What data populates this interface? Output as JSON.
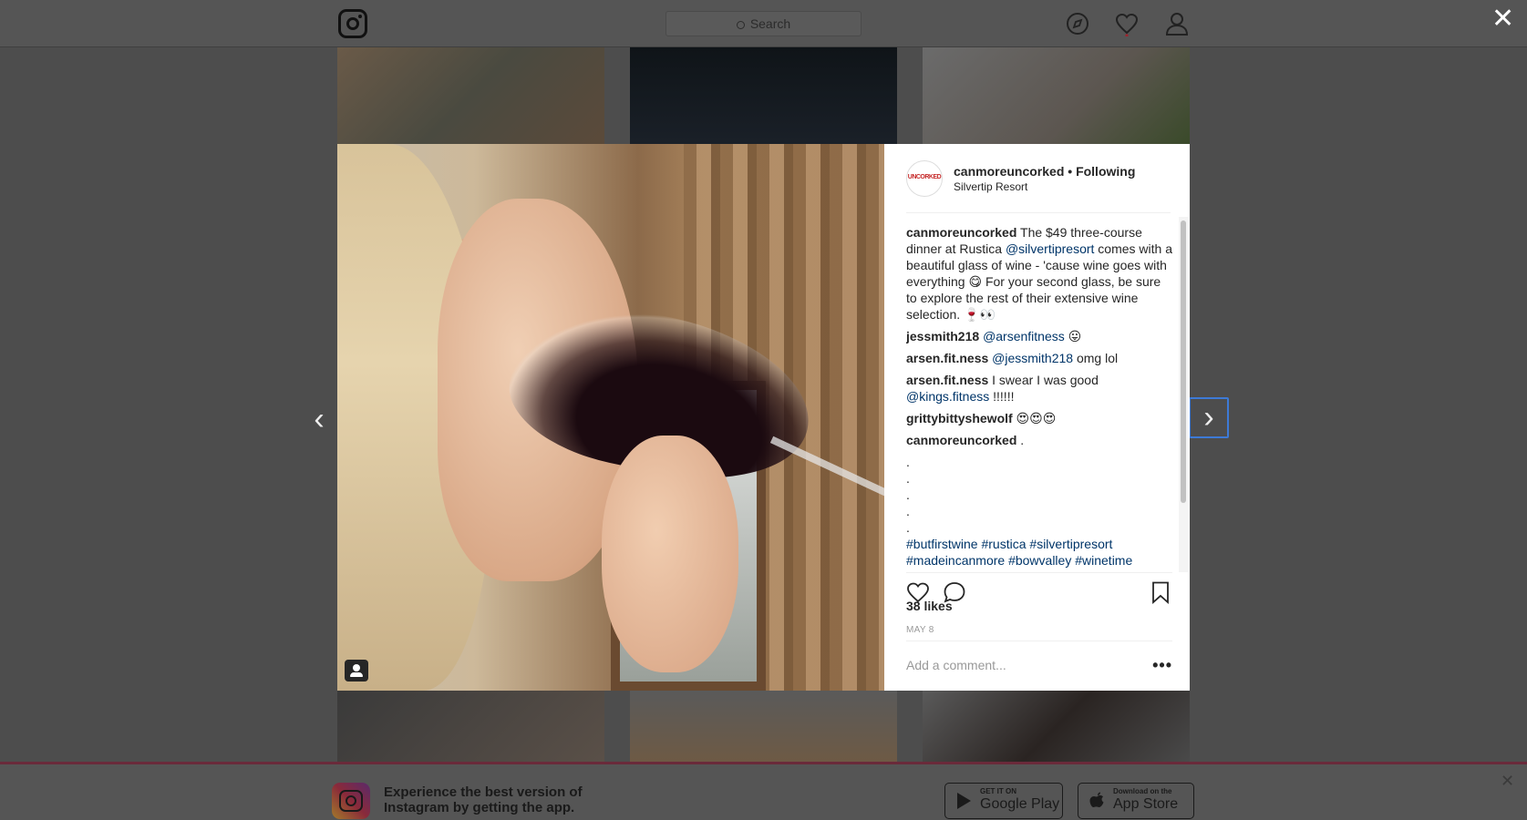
{
  "topbar": {
    "logo": "instagram-logo",
    "search_placeholder": "Search",
    "icons": [
      "compass-icon",
      "heart-icon",
      "user-icon"
    ]
  },
  "modal": {
    "header": {
      "username": "canmoreuncorked",
      "separator": " • ",
      "follow_status": "Following",
      "location": "Silvertip Resort",
      "avatar_text": "UNCORKED"
    },
    "comments": [
      {
        "user": "canmoreuncorked",
        "segments": [
          {
            "t": " The $49 three-course dinner at Rustica "
          },
          {
            "m": "@silvertipresort"
          },
          {
            "t": " comes with a beautiful glass of wine - 'cause wine goes with everything 😋 For your second glass, be sure to explore the rest of their extensive wine selection. 🍷👀"
          }
        ]
      },
      {
        "user": "jessmith218",
        "segments": [
          {
            "t": " "
          },
          {
            "m": "@arsenfitness"
          },
          {
            "t": " 😛"
          }
        ]
      },
      {
        "user": "arsen.fit.ness",
        "segments": [
          {
            "t": " "
          },
          {
            "m": "@jessmith218"
          },
          {
            "t": " omg lol"
          }
        ]
      },
      {
        "user": "arsen.fit.ness",
        "segments": [
          {
            "t": " I swear I was good "
          },
          {
            "m": "@kings.fitness"
          },
          {
            "t": " !!!!!!"
          }
        ]
      },
      {
        "user": "grittybittyshewolf",
        "segments": [
          {
            "t": " 😍😍😍"
          }
        ]
      },
      {
        "user": "canmoreuncorked",
        "segments": [
          {
            "t": " ."
          }
        ]
      }
    ],
    "dots": [
      ".",
      ".",
      ".",
      ".",
      "."
    ],
    "hashtags": [
      "#butfirstwine",
      "#rustica",
      "#silvertipresort",
      "#madeincanmore",
      "#bowvalley",
      "#winetime"
    ],
    "likes": "38 likes",
    "date": "MAY 8",
    "add_comment_placeholder": "Add a comment...",
    "more": "•••"
  },
  "banner": {
    "text_line1": "Experience the best version of",
    "text_line2": "Instagram by getting the app.",
    "google_small": "GET IT ON",
    "google_big": "Google Play",
    "apple_small": "Download on the",
    "apple_big": "App Store"
  },
  "colors": {
    "mention": "#003569",
    "overlay": "#4d4d4d",
    "focus_ring": "#3d7ad6"
  }
}
